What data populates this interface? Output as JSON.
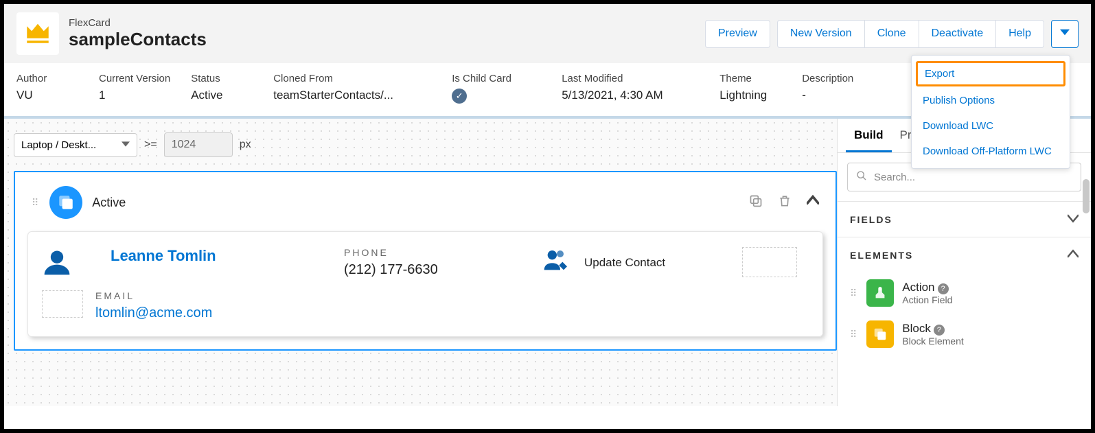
{
  "header": {
    "type": "FlexCard",
    "name": "sampleContacts",
    "buttons": {
      "preview": "Preview",
      "newVersion": "New Version",
      "clone": "Clone",
      "deactivate": "Deactivate",
      "help": "Help"
    }
  },
  "dropdown": {
    "export": "Export",
    "publishOptions": "Publish Options",
    "downloadLwc": "Download LWC",
    "downloadOff": "Download Off-Platform LWC"
  },
  "meta": {
    "author": {
      "label": "Author",
      "value": "VU"
    },
    "version": {
      "label": "Current Version",
      "value": "1"
    },
    "status": {
      "label": "Status",
      "value": "Active"
    },
    "clonedFrom": {
      "label": "Cloned From",
      "value": "teamStarterContacts/..."
    },
    "isChild": {
      "label": "Is Child Card"
    },
    "lastModified": {
      "label": "Last Modified",
      "value": "5/13/2021, 4:30 AM"
    },
    "theme": {
      "label": "Theme",
      "value": "Lightning"
    },
    "description": {
      "label": "Description",
      "value": "-"
    }
  },
  "toolbar": {
    "device": "Laptop / Deskt...",
    "op": ">=",
    "width": "1024",
    "unit": "px"
  },
  "state": {
    "title": "Active"
  },
  "card": {
    "name": "Leanne Tomlin",
    "phoneLabel": "PHONE",
    "phone": "(212) 177-6630",
    "actionText": "Update Contact",
    "emailLabel": "EMAIL",
    "email": "ltomlin@acme.com"
  },
  "panel": {
    "tabs": {
      "build": "Build",
      "properties": "Prope"
    },
    "searchPlaceholder": "Search...",
    "fields": "FIELDS",
    "elements": "ELEMENTS",
    "items": {
      "action": {
        "title": "Action",
        "sub": "Action Field"
      },
      "block": {
        "title": "Block",
        "sub": "Block Element"
      }
    }
  }
}
